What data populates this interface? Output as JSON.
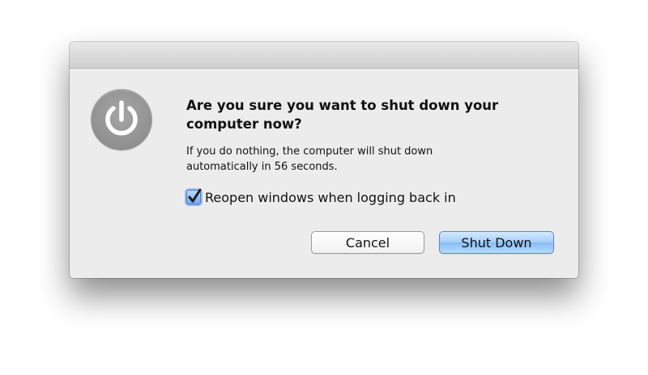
{
  "dialog": {
    "heading": "Are you sure you want to shut down your computer now?",
    "info_line1": "If you do nothing, the computer will shut down",
    "info_line2": "automatically in 56 seconds.",
    "reopen_label": "Reopen windows when logging back in",
    "reopen_checked": true,
    "icon": "power-icon",
    "cancel_label": "Cancel",
    "shutdown_label": "Shut Down",
    "accent_color": "#86bdf5",
    "icon_color": "#8c8c8c"
  }
}
